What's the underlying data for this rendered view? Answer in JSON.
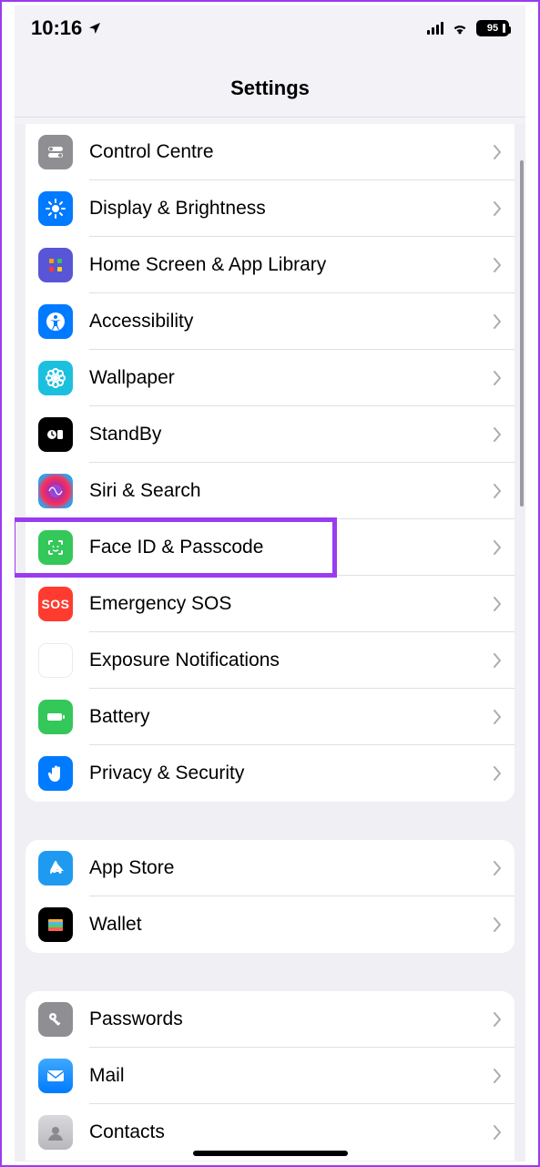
{
  "statusbar": {
    "time": "10:16",
    "battery": "95"
  },
  "header": {
    "title": "Settings"
  },
  "groups": [
    {
      "id": "g1",
      "items": [
        {
          "id": "control-centre",
          "label": "Control Centre",
          "icon": "switches-icon",
          "color": "ic-grey"
        },
        {
          "id": "display",
          "label": "Display & Brightness",
          "icon": "sun-icon",
          "color": "ic-blue"
        },
        {
          "id": "home-screen",
          "label": "Home Screen & App Library",
          "icon": "grid-icon",
          "color": "ic-purple"
        },
        {
          "id": "accessibility",
          "label": "Accessibility",
          "icon": "accessibility-icon",
          "color": "ic-blue"
        },
        {
          "id": "wallpaper",
          "label": "Wallpaper",
          "icon": "flower-icon",
          "color": "ic-cyan"
        },
        {
          "id": "standby",
          "label": "StandBy",
          "icon": "clock-widget-icon",
          "color": "ic-black"
        },
        {
          "id": "siri",
          "label": "Siri & Search",
          "icon": "siri-icon",
          "color": "ic-siri"
        },
        {
          "id": "faceid",
          "label": "Face ID & Passcode",
          "icon": "faceid-icon",
          "color": "ic-green",
          "highlighted": true
        },
        {
          "id": "sos",
          "label": "Emergency SOS",
          "icon": "sos-icon",
          "color": "ic-red"
        },
        {
          "id": "exposure",
          "label": "Exposure Notifications",
          "icon": "virus-icon",
          "color": "ic-white"
        },
        {
          "id": "battery",
          "label": "Battery",
          "icon": "battery-icon",
          "color": "ic-green"
        },
        {
          "id": "privacy",
          "label": "Privacy & Security",
          "icon": "hand-icon",
          "color": "ic-blue"
        }
      ]
    },
    {
      "id": "g2",
      "items": [
        {
          "id": "appstore",
          "label": "App Store",
          "icon": "appstore-icon",
          "color": "ic-appstore"
        },
        {
          "id": "wallet",
          "label": "Wallet",
          "icon": "wallet-icon",
          "color": "ic-wallet"
        }
      ]
    },
    {
      "id": "g3",
      "items": [
        {
          "id": "passwords",
          "label": "Passwords",
          "icon": "key-icon",
          "color": "ic-grey"
        },
        {
          "id": "mail",
          "label": "Mail",
          "icon": "mail-icon",
          "color": "ic-mail"
        },
        {
          "id": "contacts",
          "label": "Contacts",
          "icon": "contacts-icon",
          "color": "ic-contacts"
        }
      ]
    }
  ]
}
